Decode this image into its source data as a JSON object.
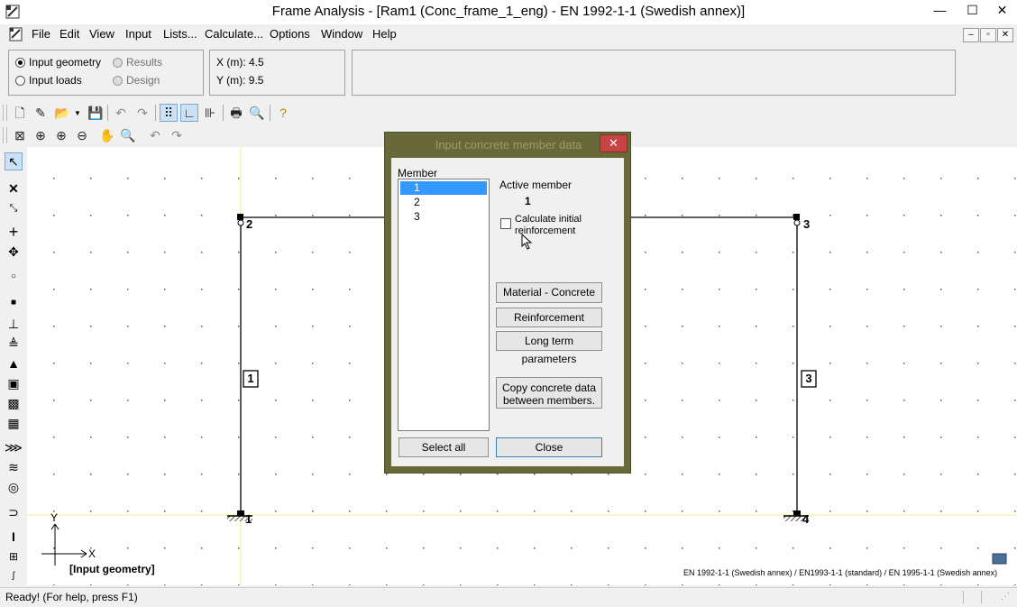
{
  "window": {
    "title": "Frame Analysis  - [Ram1 (Conc_frame_1_eng) - EN 1992-1-1 (Swedish annex)]",
    "minimize_glyph": "—",
    "maximize_glyph": "☐",
    "close_glyph": "✕"
  },
  "menu": [
    "File",
    "Edit",
    "View",
    "Input",
    "Lists...",
    "Calculate...",
    "Options",
    "Window",
    "Help"
  ],
  "mdi_controls": [
    "–",
    "▫",
    "✕"
  ],
  "mode_panel": {
    "input_geometry": "Input geometry",
    "input_loads": "Input loads",
    "results": "Results",
    "design": "Design"
  },
  "coords": {
    "x": "X (m):  4.5",
    "y": "Y (m):  9.5"
  },
  "canvas": {
    "node_labels": [
      "2",
      "3",
      "1",
      "4"
    ],
    "member_labels": [
      "1",
      "3"
    ],
    "axis_y": "Y",
    "axis_x": "X",
    "mode_label": "[Input geometry]",
    "standards": "EN 1992-1-1 (Swedish annex) / EN1993-1-1 (standard) / EN 1995-1-1 (Swedish annex)"
  },
  "dialog": {
    "title": "Input concrete member data",
    "close_glyph": "✕",
    "member_header": "Member",
    "members": [
      "1",
      "2",
      "3"
    ],
    "active_member_label": "Active member",
    "active_member_value": "1",
    "calc_initial_line1": "Calculate initial",
    "calc_initial_line2": "reinforcement",
    "material_button": "Material - Concrete",
    "reinforcement_button": "Reinforcement",
    "longterm_button": "Long term parameters",
    "copy_line1": "Copy concrete data",
    "copy_line2": "between members.",
    "select_all_button": "Select all",
    "close_button": "Close"
  },
  "status": {
    "text": "Ready!  (For help, press F1)"
  },
  "colors": {
    "dialog_frame": "#676a38",
    "selection": "#3399ff",
    "yellow_axis": "#ffff66",
    "close_red": "#c74444"
  }
}
